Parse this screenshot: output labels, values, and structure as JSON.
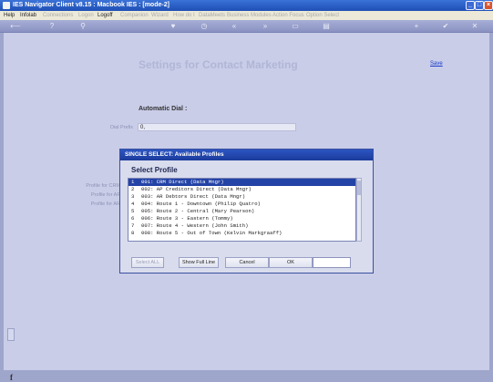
{
  "window": {
    "title": "IES Navigator Client v8.15 : Macbook IES :     [mode-2]"
  },
  "menubar": {
    "items": [
      {
        "label": "Help",
        "enabled": true
      },
      {
        "label": "Infolab",
        "enabled": true
      },
      {
        "label": "Connections",
        "enabled": false
      },
      {
        "label": "Logon",
        "enabled": false
      },
      {
        "label": "Logoff",
        "enabled": true
      },
      {
        "label": "Companion",
        "enabled": false
      },
      {
        "label": "Wizard",
        "enabled": false
      },
      {
        "label": "How do I",
        "enabled": false
      },
      {
        "label": "DataMeets",
        "enabled": false
      },
      {
        "label": "Business Modules",
        "enabled": false
      },
      {
        "label": "Action Focus",
        "enabled": false
      },
      {
        "label": "Option Select",
        "enabled": false
      }
    ]
  },
  "toolbar": {
    "icons": [
      "back-icon",
      "help-icon",
      "search-icon",
      "heart-icon",
      "clock-icon",
      "rewind-icon",
      "forward-icon",
      "pages-icon",
      "list-icon",
      "plus-icon",
      "check-icon",
      "close-icon"
    ]
  },
  "main": {
    "heading": "Settings for Contact Marketing",
    "save_label": "Save",
    "auto_dial_label": "Automatic Dial :",
    "dial_prefix_label": "Dial Prefix",
    "dial_prefix_value": "0,",
    "bg_labels": [
      "Profile for CRM",
      "Profile for AP",
      "Profile for AR"
    ]
  },
  "dialog": {
    "title": "SINGLE SELECT: Available Profiles",
    "heading": "Select Profile",
    "rows": [
      {
        "num": "1",
        "text": "001: CRM Direct (Data Mngr)"
      },
      {
        "num": "2",
        "text": "002: AP Creditors Direct (Data Mngr)"
      },
      {
        "num": "3",
        "text": "003: AR Debtors Direct (Data Mngr)"
      },
      {
        "num": "4",
        "text": "004: Route 1 - Downtown (Philip Quatro)"
      },
      {
        "num": "5",
        "text": "005: Route 2 - Central (Mary Pearson)"
      },
      {
        "num": "6",
        "text": "006: Route 3 - Eastern (Tommy)"
      },
      {
        "num": "7",
        "text": "007: Route 4 - Western (John Smith)"
      },
      {
        "num": "8",
        "text": "008: Route 5 - Out of Town (Kelvin Markgraaff)"
      }
    ],
    "selected_index": 0,
    "buttons": {
      "select_all": "Select ALL",
      "show_full_line": "Show Full Line",
      "cancel": "Cancel",
      "ok": "OK"
    }
  },
  "colors": {
    "title_bar": "#1f4fb5",
    "background": "#c9cde8",
    "selection": "#2443a6"
  }
}
